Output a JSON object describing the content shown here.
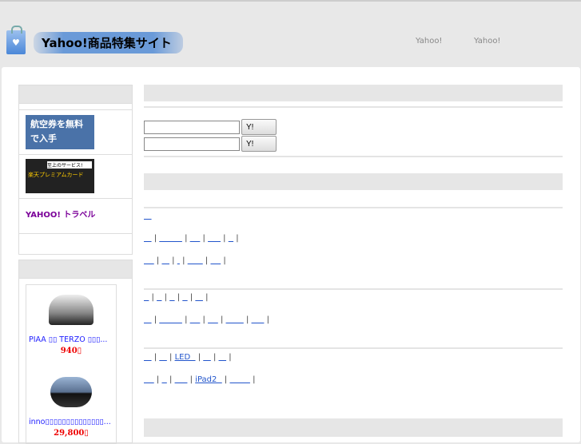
{
  "header": {
    "site_title": "Yahoo!商品特集サイト",
    "nav": [
      "Yahoo!",
      "Yahoo!"
    ]
  },
  "sidebar": {
    "banners": [
      {
        "text": "航空券を無料で入手",
        "bg": "#4a72a8"
      },
      {
        "text": "楽天プレミアムカード",
        "sub": "至上のサービス!",
        "bg": "#222"
      },
      {
        "text": "YAHOO! トラベル",
        "bg": "#fff"
      }
    ],
    "products": [
      {
        "name": "PIAA ▯▯ TERZO ▯▯▯...",
        "price": "940▯"
      },
      {
        "name": "inno▯▯▯▯▯▯▯▯▯▯▯▯▯▯...",
        "price": "29,800▯"
      }
    ]
  },
  "search": {
    "button1": "Y!",
    "button2": "Y!",
    "value1": "",
    "value2": ""
  },
  "link_rows": [
    [
      "   "
    ],
    [
      "   ",
      "         ",
      "    ",
      "     ",
      "  "
    ],
    [
      "    ",
      "   ",
      " ",
      "      ",
      "    "
    ],
    [
      "  ",
      "  ",
      "  ",
      "  ",
      "   "
    ],
    [
      "   ",
      "         ",
      "    ",
      "    ",
      "       ",
      "     "
    ],
    [
      "   ",
      "   ",
      "LED  ",
      "   ",
      "   "
    ],
    [
      "    ",
      "  ",
      "     ",
      "iPad2  ",
      "        "
    ]
  ],
  "colors": {
    "link": "#2255cc",
    "price": "#ee0000"
  }
}
